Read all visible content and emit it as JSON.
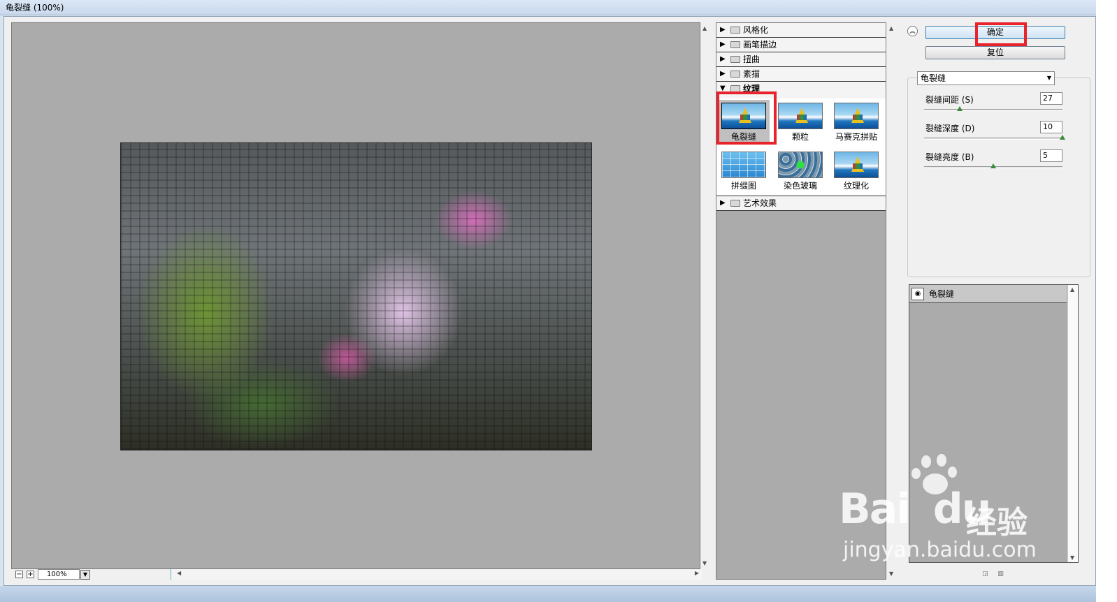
{
  "window": {
    "title": "龟裂缝 (100%)"
  },
  "preview": {
    "zoom": "100%"
  },
  "gallery": {
    "categories_top": [
      "风格化",
      "画笔描边",
      "扭曲",
      "素描"
    ],
    "open_category": "纹理",
    "filters": [
      {
        "label": "龟裂缝",
        "selected": true,
        "thumb": "boat"
      },
      {
        "label": "颗粒",
        "selected": false,
        "thumb": "boat"
      },
      {
        "label": "马赛克拼贴",
        "selected": false,
        "thumb": "boat"
      },
      {
        "label": "拼缀图",
        "selected": false,
        "thumb": "grid"
      },
      {
        "label": "染色玻璃",
        "selected": false,
        "thumb": "cells"
      },
      {
        "label": "纹理化",
        "selected": false,
        "thumb": "boat"
      }
    ],
    "categories_bottom": [
      "艺术效果"
    ]
  },
  "buttons": {
    "ok": "确定",
    "reset": "复位"
  },
  "filter_select": {
    "value": "龟裂缝"
  },
  "params": [
    {
      "label": "裂缝间距 (S)",
      "value": "27",
      "fraction": 0.26
    },
    {
      "label": "裂缝深度 (D)",
      "value": "10",
      "fraction": 1.0
    },
    {
      "label": "裂缝亮度 (B)",
      "value": "5",
      "fraction": 0.5
    }
  ],
  "layers": [
    {
      "name": "龟裂缝"
    }
  ],
  "watermark": {
    "brand": "Bai",
    "brand2": "du",
    "cn": "经验",
    "url": "jingyan.baidu.com"
  },
  "colors": {
    "highlight": "#e8232b",
    "canvas": "#ababab"
  }
}
